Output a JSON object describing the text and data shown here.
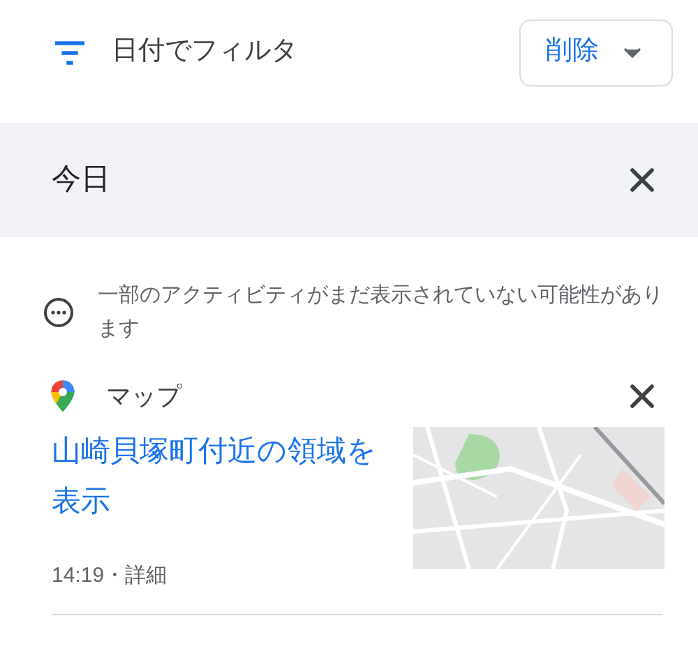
{
  "filter": {
    "label": "日付でフィルタ"
  },
  "delete_button": {
    "label": "削除"
  },
  "section": {
    "title": "今日"
  },
  "notice": {
    "text": "一部のアクティビティがまだ表示されていない可能性があります"
  },
  "activity": {
    "app": "マップ",
    "title": "山崎貝塚町付近の領域を表示",
    "meta": "14:19・詳細"
  }
}
